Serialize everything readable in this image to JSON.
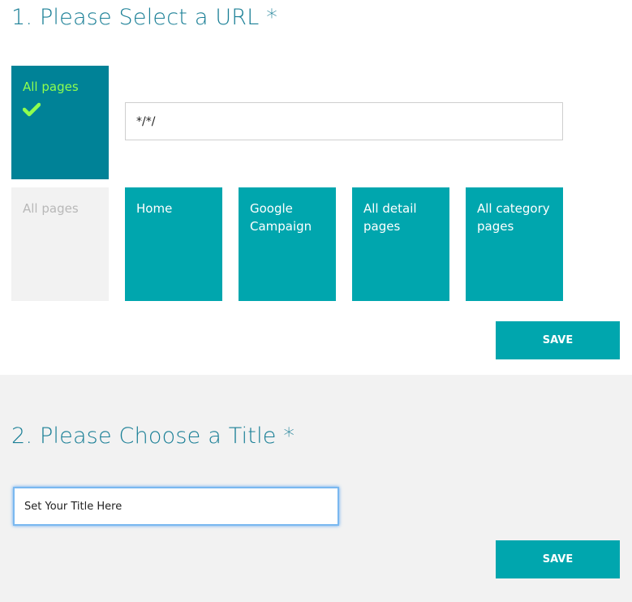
{
  "section1": {
    "heading": "1. Please Select a URL *",
    "selected_tile": {
      "label": "All pages",
      "icon": "checkmark-icon"
    },
    "url_input": {
      "value": "*/*/"
    },
    "tiles": [
      {
        "label": "All pages",
        "state": "disabled"
      },
      {
        "label": "Home",
        "state": "active"
      },
      {
        "label": "Google Campaign",
        "state": "active"
      },
      {
        "label": "All detail pages",
        "state": "active"
      },
      {
        "label": "All category pages",
        "state": "active"
      }
    ],
    "save_label": "SAVE"
  },
  "section2": {
    "heading": "2. Please Choose a Title *",
    "title_input": {
      "value": "Set Your Title Here"
    },
    "save_label": "SAVE"
  },
  "colors": {
    "heading": "#1a7f96",
    "tile": "#00a6ae",
    "tile_selected": "#008297",
    "check": "#8eff4f",
    "tile_disabled": "#f2f2f2"
  }
}
